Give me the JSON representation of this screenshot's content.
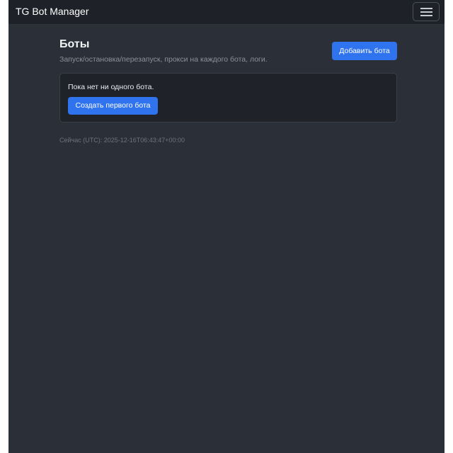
{
  "navbar": {
    "brand": "TG Bot Manager",
    "toggle_icon": "hamburger-menu-icon"
  },
  "header": {
    "title": "Боты",
    "subtitle": "Запуск/остановка/перезапуск, прокси на каждого бота, логи.",
    "add_button_label": "Добавить бота"
  },
  "empty_state": {
    "message": "Пока нет ни одного бота.",
    "create_button_label": "Создать первого бота"
  },
  "footer": {
    "server_time": "Сейчас (UTC): 2025-12-16T06:43:47+00:00"
  },
  "colors": {
    "background": "#2b3038",
    "navbar": "#1e2127",
    "card": "#1f2228",
    "primary": "#2f73ee",
    "muted_text": "#8a919c"
  }
}
